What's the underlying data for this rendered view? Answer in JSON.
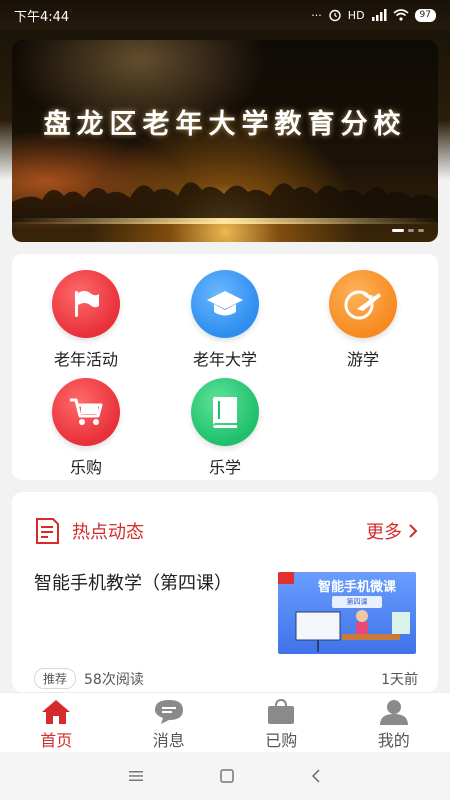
{
  "status_bar": {
    "time": "下午4:44",
    "dots": "···",
    "network": "HD",
    "battery": "97"
  },
  "banner": {
    "title": "盘龙区老年大学教育分校"
  },
  "grid": {
    "items": [
      {
        "label": "老年活动",
        "icon": "flag-icon",
        "color": "#e8303a"
      },
      {
        "label": "老年大学",
        "icon": "graduation-cap-icon",
        "color": "#2e8df0"
      },
      {
        "label": "游学",
        "icon": "airplane-icon",
        "color": "#f58a1f"
      },
      {
        "label": "乐购",
        "icon": "shopping-cart-icon",
        "color": "#e8303a"
      },
      {
        "label": "乐学",
        "icon": "book-icon",
        "color": "#1fbf6c"
      }
    ]
  },
  "news": {
    "section_title": "热点动态",
    "more_label": "更多",
    "article": {
      "title": "智能手机教学（第四课）",
      "thumb_title": "智能手机微课",
      "thumb_sub": "第四课",
      "tag": "推荐",
      "reads": "58次阅读",
      "time": "1天前"
    }
  },
  "bottom_nav": {
    "items": [
      {
        "label": "首页",
        "icon": "home-icon",
        "active": true
      },
      {
        "label": "消息",
        "icon": "message-icon",
        "active": false
      },
      {
        "label": "已购",
        "icon": "shopping-bag-icon",
        "active": false
      },
      {
        "label": "我的",
        "icon": "user-icon",
        "active": false
      }
    ]
  },
  "colors": {
    "accent": "#d62b2b",
    "background": "#f2f2f2"
  }
}
